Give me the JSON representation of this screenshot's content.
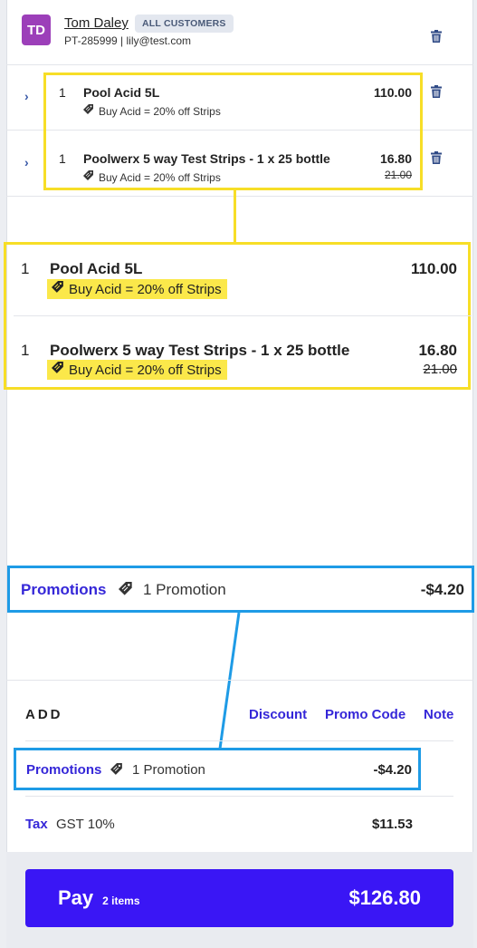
{
  "customer": {
    "initials": "TD",
    "name": "Tom Daley",
    "group": "ALL CUSTOMERS",
    "meta": "PT-285999 | lily@test.com",
    "avatar_color": "#9c3fb9"
  },
  "items": [
    {
      "qty": "1",
      "name": "Pool Acid 5L",
      "promo": "Buy Acid = 20% off Strips",
      "price": "110.00",
      "original": ""
    },
    {
      "qty": "1",
      "name": "Poolwerx 5 way Test Strips - 1 x 25 bottle",
      "promo": "Buy Acid = 20% off Strips",
      "price": "16.80",
      "original": "21.00"
    }
  ],
  "promotions": {
    "label": "Promotions",
    "count": "1 Promotion",
    "amount": "-$4.20"
  },
  "add": {
    "title": "ADD",
    "discount": "Discount",
    "promo_code": "Promo Code",
    "note": "Note"
  },
  "tax": {
    "label": "Tax",
    "name": "GST 10%",
    "amount": "$11.53"
  },
  "pay": {
    "label": "Pay",
    "items": "2 items",
    "total": "$126.80"
  },
  "colors": {
    "accent": "#3527d8",
    "pay_button": "#3a16f5",
    "highlight_yellow": "#f7de27",
    "highlight_blue": "#1e9be6"
  },
  "icons": {
    "trash": "trash-icon",
    "chevron": "chevron-right-icon",
    "tag": "tag-icon"
  }
}
